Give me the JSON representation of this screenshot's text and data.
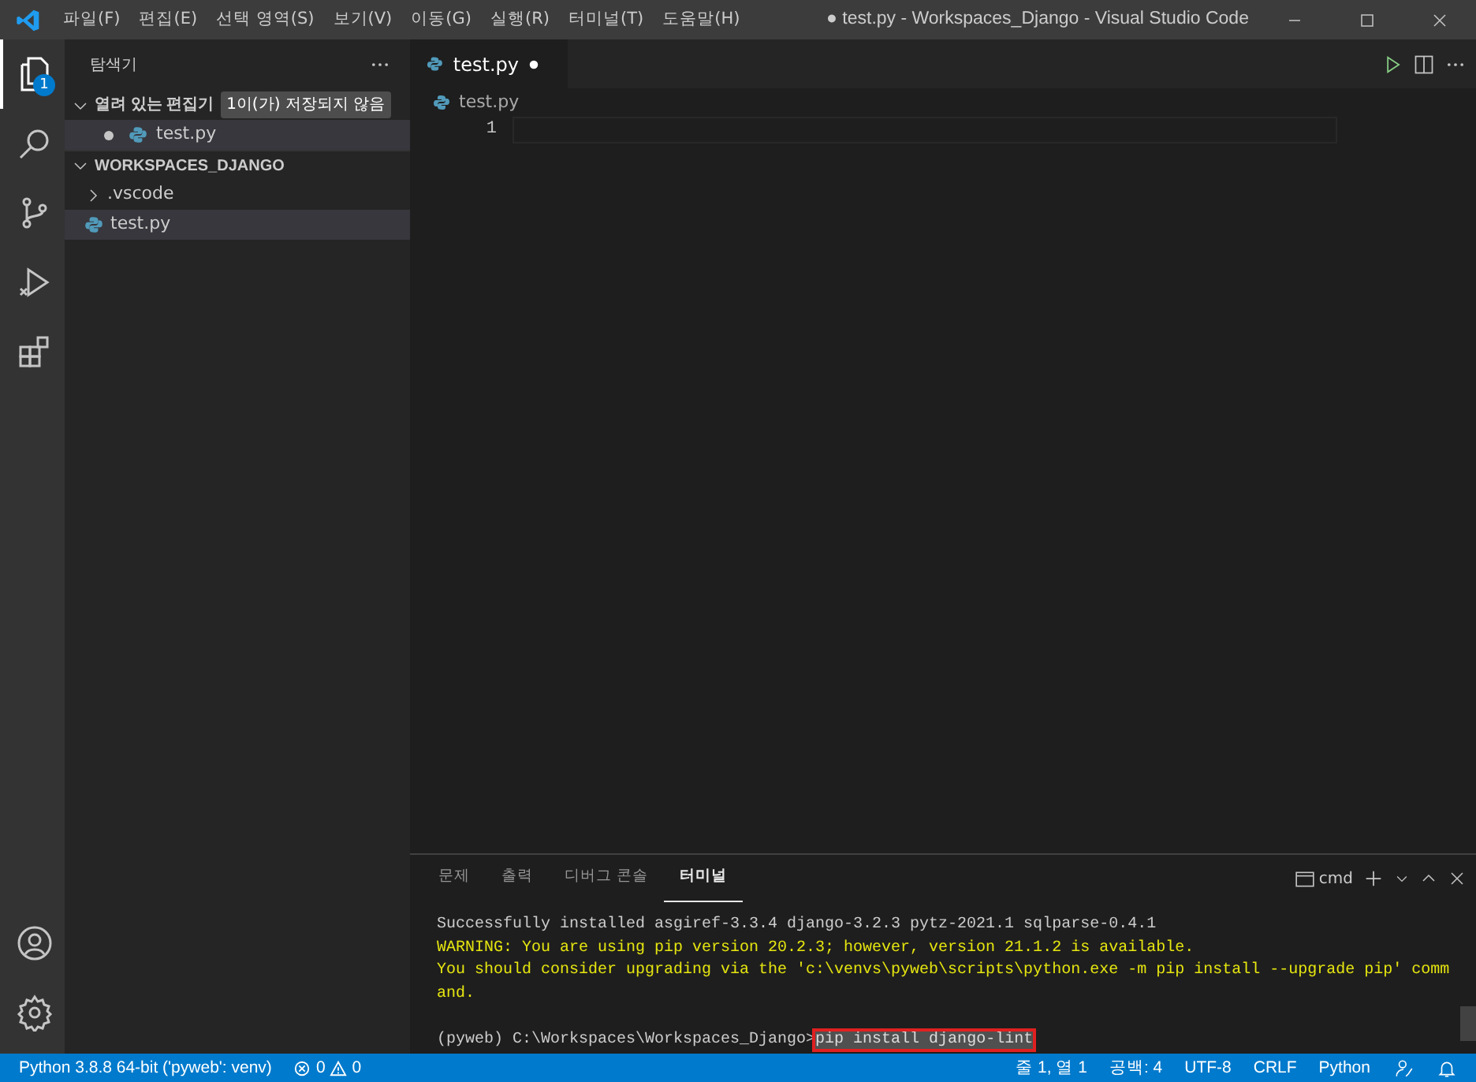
{
  "window": {
    "title": "● test.py - Workspaces_Django - Visual Studio Code"
  },
  "menu": [
    "파일(F)",
    "편집(E)",
    "선택 영역(S)",
    "보기(V)",
    "이동(G)",
    "실행(R)",
    "터미널(T)",
    "도움말(H)"
  ],
  "activity_bar": [
    {
      "kind": "explorer",
      "selected": true,
      "badge": "1"
    },
    {
      "kind": "search",
      "selected": false
    },
    {
      "kind": "source-control",
      "selected": false
    },
    {
      "kind": "run",
      "selected": false
    },
    {
      "kind": "extensions",
      "selected": false
    }
  ],
  "sidebar": {
    "title": "탐색기",
    "open_editors": {
      "label": "열려 있는 편집기",
      "expanded": true,
      "badge": "1이(가) 저장되지 않음",
      "items": [
        {
          "label": "test.py",
          "modified": true,
          "selected": true
        }
      ]
    },
    "workspace": {
      "label": "WORKSPACES_DJANGO",
      "expanded": true,
      "children": [
        {
          "label": ".vscode",
          "kind": "folder",
          "expanded": false,
          "selected": false
        },
        {
          "label": "test.py",
          "kind": "file",
          "selected": true
        }
      ]
    }
  },
  "editor": {
    "tabs": [
      {
        "label": "test.py",
        "modified": true,
        "selected": true
      }
    ],
    "breadcrumb": "test.py",
    "line_numbers": [
      "1"
    ]
  },
  "panel": {
    "tabs": [
      {
        "label": "문제",
        "selected": false
      },
      {
        "label": "출력",
        "selected": false
      },
      {
        "label": "디버그 콘솔",
        "selected": false
      },
      {
        "label": "터미널",
        "selected": true
      }
    ],
    "terminal_profile": "cmd",
    "lines": [
      {
        "kind": "normal",
        "text": "Successfully installed asgiref-3.3.4 django-3.2.3 pytz-2021.1 sqlparse-0.4.1"
      },
      {
        "kind": "warning",
        "text": "WARNING: You are using pip version 20.2.3; however, version 21.1.2 is available."
      },
      {
        "kind": "warning",
        "text": "You should consider upgrading via the 'c:\\venvs\\pyweb\\scripts\\python.exe -m pip install --upgrade pip' comm"
      },
      {
        "kind": "warning",
        "text": "and."
      },
      {
        "kind": "blank"
      }
    ],
    "prompt": "(pyweb) C:\\Workspaces\\Workspaces_Django>",
    "command": "pip install django-lint"
  },
  "status_bar": {
    "interpreter": "Python 3.8.8 64-bit ('pyweb': venv)",
    "errors": "0",
    "warnings": "0",
    "position": "줄 1, 열 1",
    "indent": "공백: 4",
    "encoding": "UTF-8",
    "eol": "CRLF",
    "language": "Python"
  }
}
